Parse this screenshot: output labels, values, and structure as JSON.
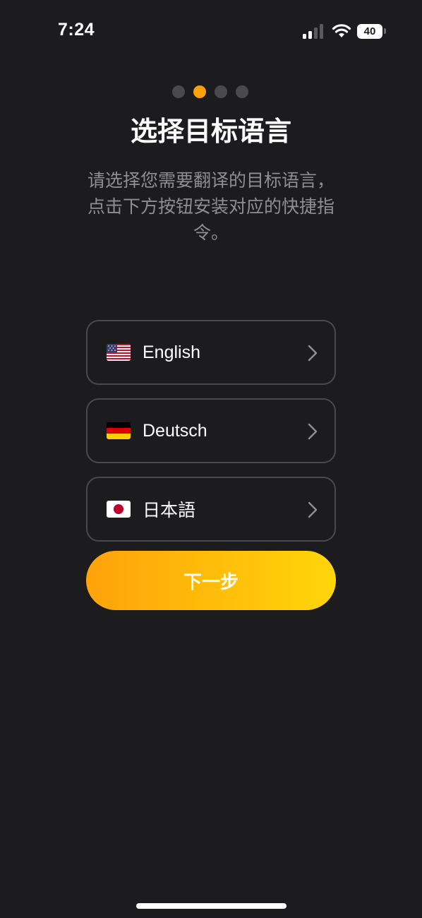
{
  "status_bar": {
    "time": "7:24",
    "battery_level": "40",
    "icons": [
      "signal-icon",
      "wifi-icon",
      "battery-icon"
    ]
  },
  "pager": {
    "total": 4,
    "active_index": 1
  },
  "header": {
    "title": "选择目标语言",
    "subtitle": "请选择您需要翻译的目标语言，点击下方按钮安装对应的快捷指令。"
  },
  "languages": [
    {
      "flag_icon": "us-flag-icon",
      "label": "English"
    },
    {
      "flag_icon": "de-flag-icon",
      "label": "Deutsch"
    },
    {
      "flag_icon": "jp-flag-icon",
      "label": "日本語"
    }
  ],
  "next_button": {
    "label": "下一步"
  },
  "colors": {
    "background": "#1c1c1e",
    "accent": "#ff9f0a",
    "accent_gradient_end": "#ffd60a",
    "muted_text": "#8e8e93",
    "border": "#4a4a4e"
  }
}
